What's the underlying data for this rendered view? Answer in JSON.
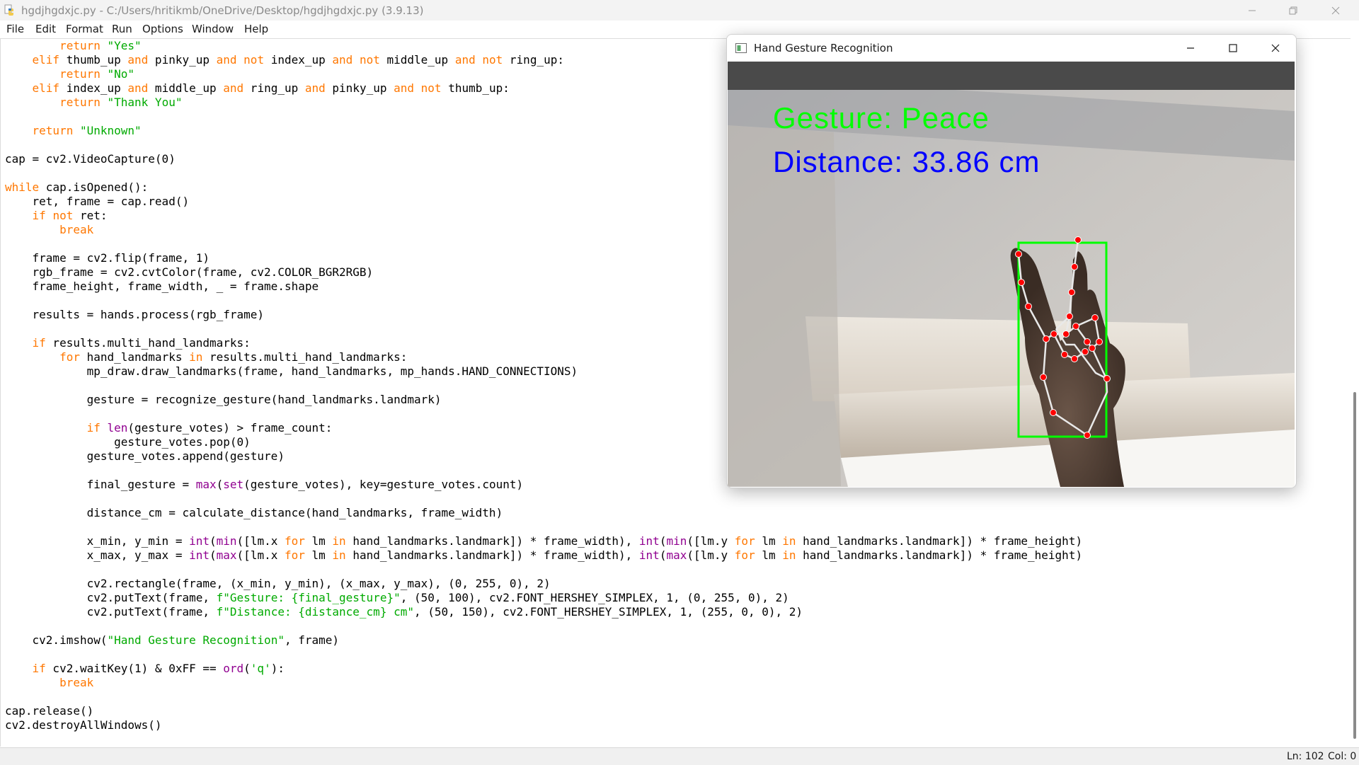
{
  "idle_window": {
    "title": "hgdjhgdxjc.py - C:/Users/hritikmb/OneDrive/Desktop/hgdjhgdxjc.py (3.9.13)",
    "menu": [
      "File",
      "Edit",
      "Format",
      "Run",
      "Options",
      "Window",
      "Help"
    ],
    "status": {
      "line": "Ln: 102",
      "col": "Col: 0"
    }
  },
  "code_lines": [
    "        return \"Yes\"",
    "    elif thumb_up and pinky_up and not index_up and not middle_up and not ring_up:",
    "        return \"No\"",
    "    elif index_up and middle_up and ring_up and pinky_up and not thumb_up:",
    "        return \"Thank You\"",
    "",
    "    return \"Unknown\"",
    "",
    "cap = cv2.VideoCapture(0)",
    "",
    "while cap.isOpened():",
    "    ret, frame = cap.read()",
    "    if not ret:",
    "        break",
    "",
    "    frame = cv2.flip(frame, 1)",
    "    rgb_frame = cv2.cvtColor(frame, cv2.COLOR_BGR2RGB)",
    "    frame_height, frame_width, _ = frame.shape",
    "",
    "    results = hands.process(rgb_frame)",
    "",
    "    if results.multi_hand_landmarks:",
    "        for hand_landmarks in results.multi_hand_landmarks:",
    "            mp_draw.draw_landmarks(frame, hand_landmarks, mp_hands.HAND_CONNECTIONS)",
    "",
    "            gesture = recognize_gesture(hand_landmarks.landmark)",
    "",
    "            if len(gesture_votes) > frame_count:",
    "                gesture_votes.pop(0)",
    "            gesture_votes.append(gesture)",
    "",
    "            final_gesture = max(set(gesture_votes), key=gesture_votes.count)",
    "",
    "            distance_cm = calculate_distance(hand_landmarks, frame_width)",
    "",
    "            x_min, y_min = int(min([lm.x for lm in hand_landmarks.landmark]) * frame_width), int(min([lm.y for lm in hand_landmarks.landmark]) * frame_height)",
    "            x_max, y_max = int(max([lm.x for lm in hand_landmarks.landmark]) * frame_width), int(max([lm.y for lm in hand_landmarks.landmark]) * frame_height)",
    "",
    "            cv2.rectangle(frame, (x_min, y_min), (x_max, y_max), (0, 255, 0), 2)",
    "            cv2.putText(frame, f\"Gesture: {final_gesture}\", (50, 100), cv2.FONT_HERSHEY_SIMPLEX, 1, (0, 255, 0), 2)",
    "            cv2.putText(frame, f\"Distance: {distance_cm} cm\", (50, 150), cv2.FONT_HERSHEY_SIMPLEX, 1, (255, 0, 0), 2)",
    "",
    "    cv2.imshow(\"Hand Gesture Recognition\", frame)",
    "",
    "    if cv2.waitKey(1) & 0xFF == ord('q'):",
    "        break",
    "",
    "cap.release()",
    "cv2.destroyAllWindows()"
  ],
  "syntax_colors": {
    "keyword": "#ff7700",
    "string": "#00aa00",
    "builtin": "#900090"
  },
  "cv_window": {
    "title": "Hand Gesture Recognition",
    "gesture_text": "Gesture: Peace",
    "distance_text": "Distance: 33.86 cm",
    "gesture_color": "#00ff00",
    "distance_color": "#0000ff"
  }
}
